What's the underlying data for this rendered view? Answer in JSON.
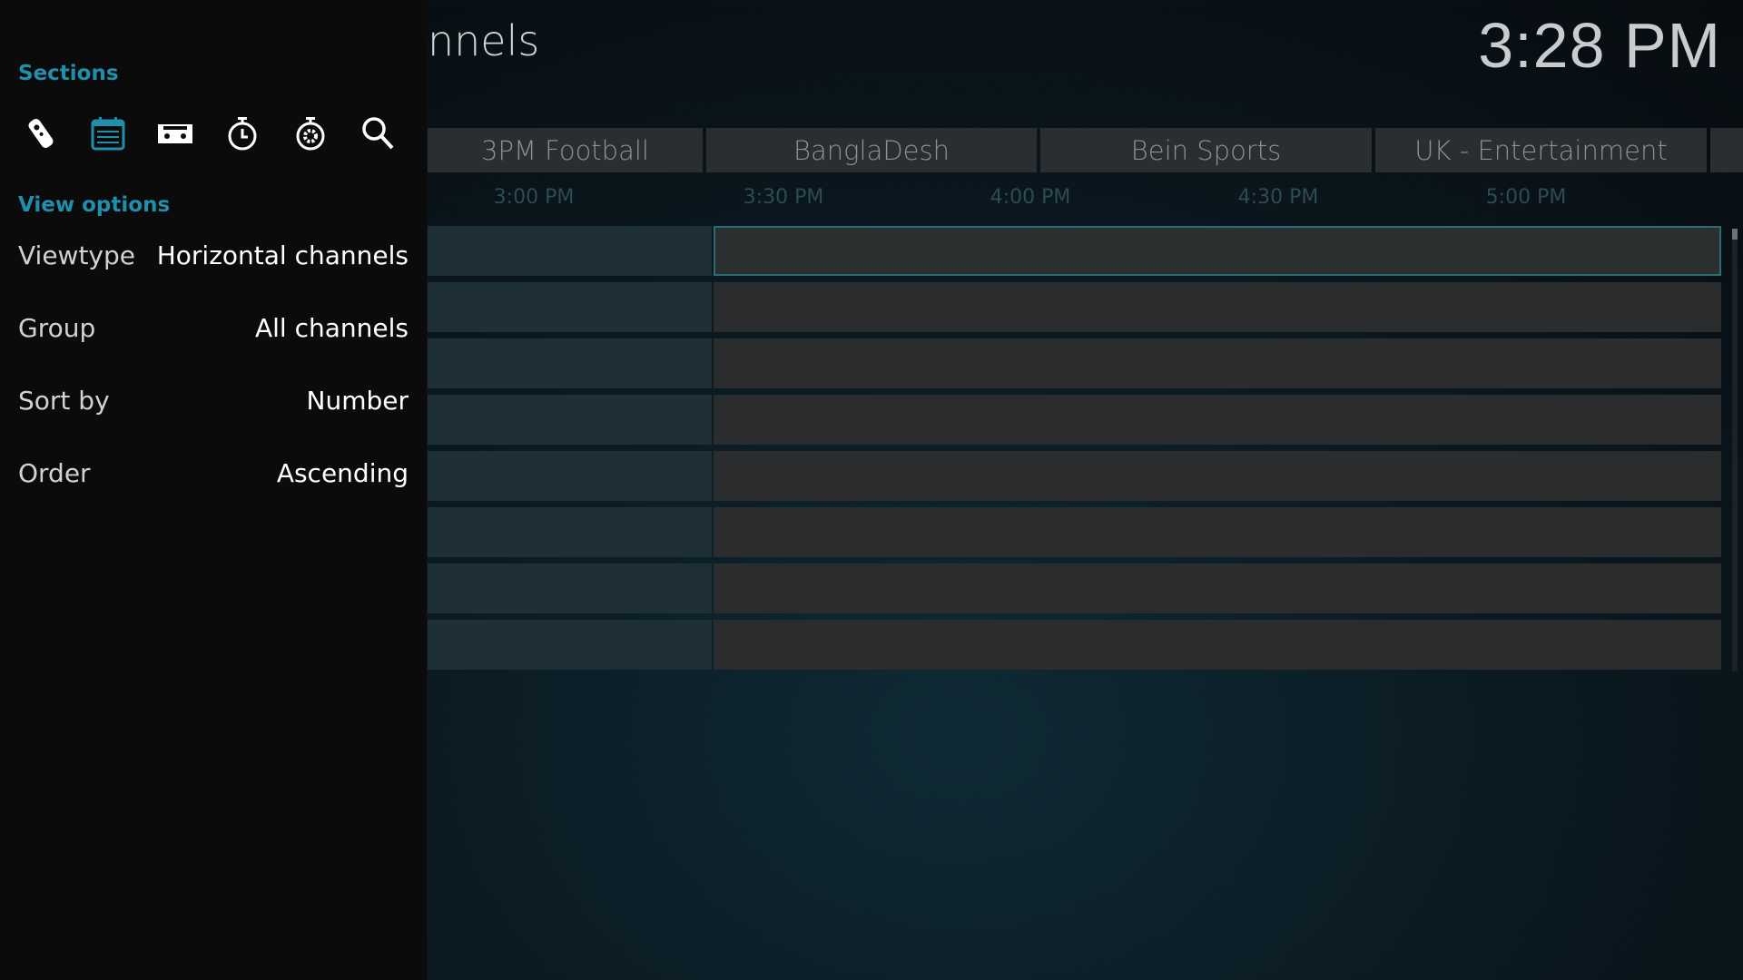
{
  "header": {
    "title": "nnels",
    "clock": "3:28 PM"
  },
  "groups": [
    "3PM Football",
    "BanglaDesh",
    "Bein Sports",
    "UK - Entertainment",
    ""
  ],
  "timeline": [
    "3:00 PM",
    "3:30 PM",
    "4:00 PM",
    "4:30 PM",
    "5:00 PM"
  ],
  "sidebar": {
    "sections_label": "Sections",
    "section_icons": [
      "remote-icon",
      "guide-icon",
      "recordings-icon",
      "timers-icon",
      "timer-rules-icon",
      "search-icon"
    ],
    "active_section": "guide-icon",
    "view_options_label": "View options",
    "options": [
      {
        "label": "Viewtype",
        "value": "Horizontal channels"
      },
      {
        "label": "Group",
        "value": "All channels"
      },
      {
        "label": "Sort by",
        "value": "Number"
      },
      {
        "label": "Order",
        "value": "Ascending"
      }
    ]
  },
  "colors": {
    "accent": "#1f8fab"
  }
}
